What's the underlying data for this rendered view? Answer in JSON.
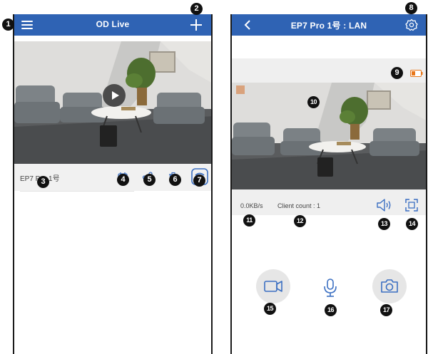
{
  "left_screen": {
    "title": "OD Live",
    "camera_name": "EP7 Pro 1号",
    "icons": {
      "menu": "menu-icon",
      "add": "plus-icon",
      "play": "play-icon",
      "playback": "playback-icon",
      "share": "share-icon",
      "delete": "trash-icon",
      "wifi": "wifi-icon"
    }
  },
  "right_screen": {
    "title": "EP7 Pro 1号 : LAN",
    "bitrate": "0.0KB/s",
    "client_count": "Client count : 1",
    "icons": {
      "back": "back-icon",
      "settings": "settings-icon",
      "battery": "battery-icon",
      "speaker": "speaker-icon",
      "fullscreen": "fullscreen-icon",
      "record": "record-icon",
      "microphone": "microphone-icon",
      "snapshot": "snapshot-icon"
    }
  },
  "callouts": [
    "1",
    "2",
    "3",
    "4",
    "5",
    "6",
    "7",
    "8",
    "9",
    "10",
    "11",
    "12",
    "13",
    "14",
    "15",
    "16",
    "17"
  ],
  "colors": {
    "header_blue": "#2f63b4",
    "icon_blue": "#3b6fc2",
    "battery_orange": "#e8771a",
    "callout_black": "#111111"
  }
}
